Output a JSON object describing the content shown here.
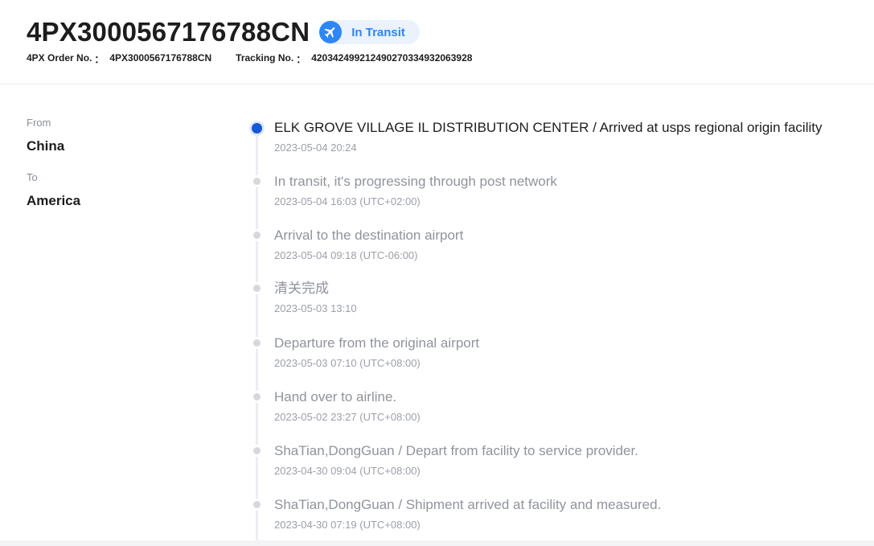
{
  "header": {
    "order_title": "4PX3000567176788CN",
    "status": {
      "label": "In Transit",
      "icon": "airplane-icon",
      "color": "#2f86f6",
      "background": "#e9f2fd"
    },
    "order_no_label": "4PX Order No.",
    "order_no_value": "4PX3000567176788CN",
    "tracking_no_label": "Tracking No.",
    "tracking_no_value": "420342499212490270334932063928",
    "separator": "："
  },
  "route": {
    "from_label": "From",
    "from_value": "China",
    "to_label": "To",
    "to_value": "America"
  },
  "timeline": {
    "active_color": "#1557d6",
    "events": [
      {
        "title": "ELK GROVE VILLAGE IL DISTRIBUTION CENTER / Arrived at usps regional origin facility",
        "time": "2023-05-04 20:24"
      },
      {
        "title": "In transit, it's progressing through post network",
        "time": "2023-05-04 16:03 (UTC+02:00)"
      },
      {
        "title": "Arrival to the destination airport",
        "time": "2023-05-04 09:18 (UTC-06:00)"
      },
      {
        "title": "清关完成",
        "time": "2023-05-03 13:10"
      },
      {
        "title": "Departure from the original airport",
        "time": "2023-05-03 07:10 (UTC+08:00)"
      },
      {
        "title": "Hand over to airline.",
        "time": "2023-05-02 23:27 (UTC+08:00)"
      },
      {
        "title": "ShaTian,DongGuan / Depart from facility to service provider.",
        "time": "2023-04-30 09:04 (UTC+08:00)"
      },
      {
        "title": "ShaTian,DongGuan / Shipment arrived at facility and measured.",
        "time": "2023-04-30 07:19 (UTC+08:00)"
      }
    ]
  }
}
